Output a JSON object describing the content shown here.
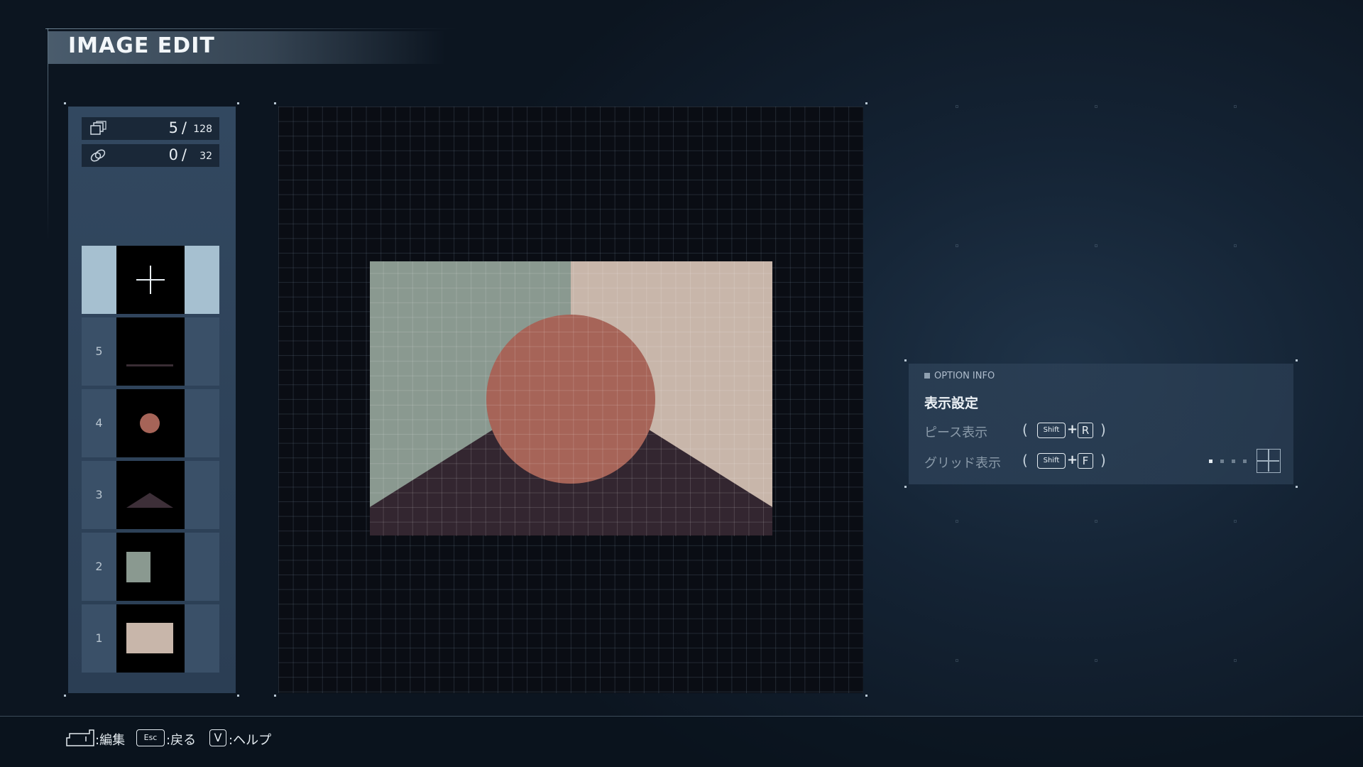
{
  "title": "IMAGE EDIT",
  "counters": [
    {
      "icon": "pieces-icon",
      "value": "5",
      "slash": "/",
      "max": "128"
    },
    {
      "icon": "link-icon",
      "value": "0",
      "slash": "/",
      "max": "32"
    }
  ],
  "layers": [
    {
      "number": "5",
      "shape": "line"
    },
    {
      "number": "4",
      "shape": "circle"
    },
    {
      "number": "3",
      "shape": "triangle"
    },
    {
      "number": "2",
      "shape": "small-rectangle"
    },
    {
      "number": "1",
      "shape": "rectangle"
    }
  ],
  "add_layer_icon": "plus-icon",
  "option_info": {
    "header": "OPTION INFO",
    "title": "表示設定",
    "rows": [
      {
        "label": "ピース表示",
        "open": "(",
        "modifier": "Shift",
        "plus": "+",
        "key": "R",
        "close": ")"
      },
      {
        "label": "グリッド表示",
        "open": "(",
        "modifier": "Shift",
        "plus": "+",
        "key": "F",
        "close": ")"
      }
    ],
    "grid_level": {
      "current": 1,
      "total": 4
    }
  },
  "bottom_hints": [
    {
      "key": "enter-key-icon",
      "label": ":編集"
    },
    {
      "key": "Esc",
      "label": ":戻る"
    },
    {
      "key": "V",
      "label": ":ヘルプ"
    }
  ],
  "colors": {
    "sage": "#8a9990",
    "beige": "#c8b6aa",
    "terracotta": "#a66458",
    "dark_mountain": "#332630",
    "selected_layer": "#a6c0d0",
    "panel": "#2f4459"
  }
}
